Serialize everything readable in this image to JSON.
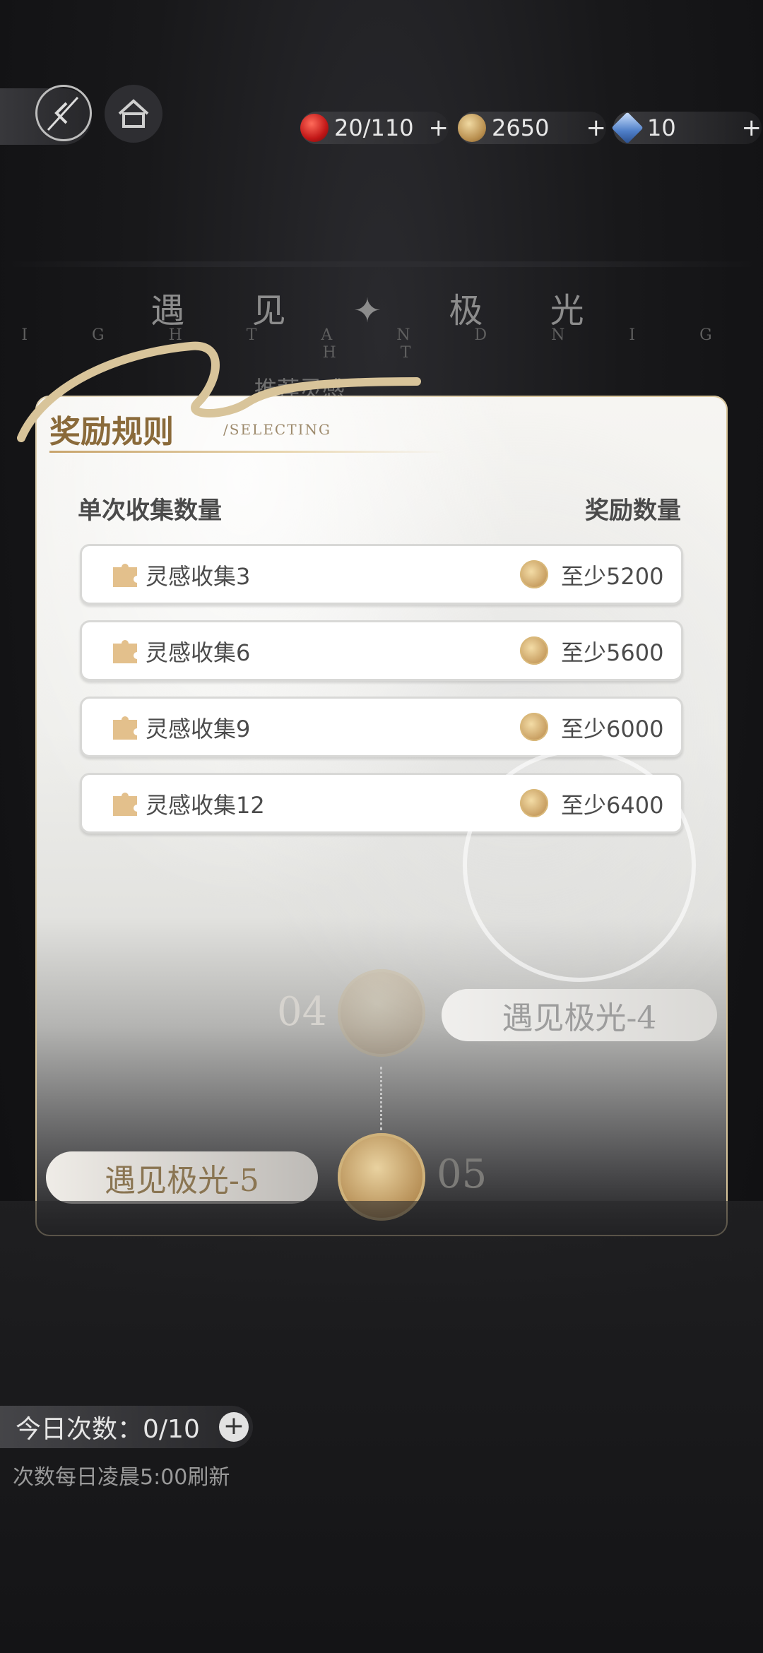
{
  "topbar": {
    "back_icon": "back-arrow-icon",
    "home_icon": "home-icon",
    "resources": [
      {
        "icon": "red-apple-icon",
        "value": "20/110",
        "plus": "+"
      },
      {
        "icon": "gold-coin-icon",
        "value": "2650",
        "plus": "+"
      },
      {
        "icon": "blue-diamond-icon",
        "value": "10",
        "plus": "+"
      }
    ]
  },
  "background": {
    "title": "遇 见 ✦ 极 光",
    "subtitle": "I G H T A N D N I G H T",
    "recommend_partial": "推荐灵感"
  },
  "panel": {
    "title": "奖励规则",
    "title_sub": "/SELECTING",
    "col_left": "单次收集数量",
    "col_right": "奖励数量",
    "rows": [
      {
        "label": "灵感收集3",
        "reward": "至少5200"
      },
      {
        "label": "灵感收集6",
        "reward": "至少5600"
      },
      {
        "label": "灵感收集9",
        "reward": "至少6000"
      },
      {
        "label": "灵感收集12",
        "reward": "至少6400"
      }
    ]
  },
  "map": {
    "node4_num": "04",
    "node4_label": "遇见极光-4",
    "node5_num": "05",
    "node5_label": "遇见极光-5"
  },
  "bottom": {
    "today_count": "今日次数：0/10",
    "plus": "+",
    "refresh_note": "次数每日凌晨5:00刷新"
  },
  "colors": {
    "accent_gold": "#c9a063",
    "panel_bg": "#f6f5f2",
    "title_brown": "#8a6a3a"
  }
}
